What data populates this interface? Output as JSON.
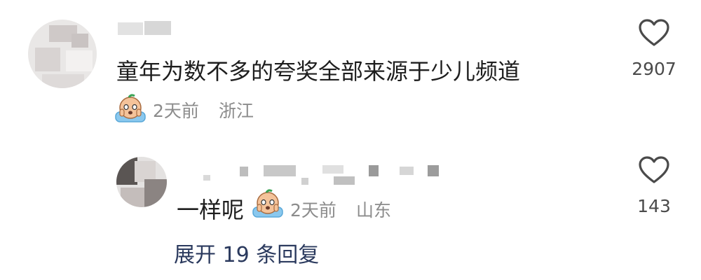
{
  "comment": {
    "text": "童年为数不多的夸奖全部来源于少儿频道",
    "time": "2天前",
    "location": "浙江",
    "likes": "2907",
    "emoji": "crying-face-emoji"
  },
  "reply": {
    "text": "一样呢",
    "time": "2天前",
    "location": "山东",
    "likes": "143",
    "emoji": "crying-face-emoji"
  },
  "expand_label": "展开 19 条回复",
  "colors": {
    "text": "#1e1e1e",
    "meta": "#8c8c8c",
    "link": "#2b3a5e",
    "emoji_face": "#f4c39a",
    "emoji_pillow": "#8ac8ee"
  }
}
